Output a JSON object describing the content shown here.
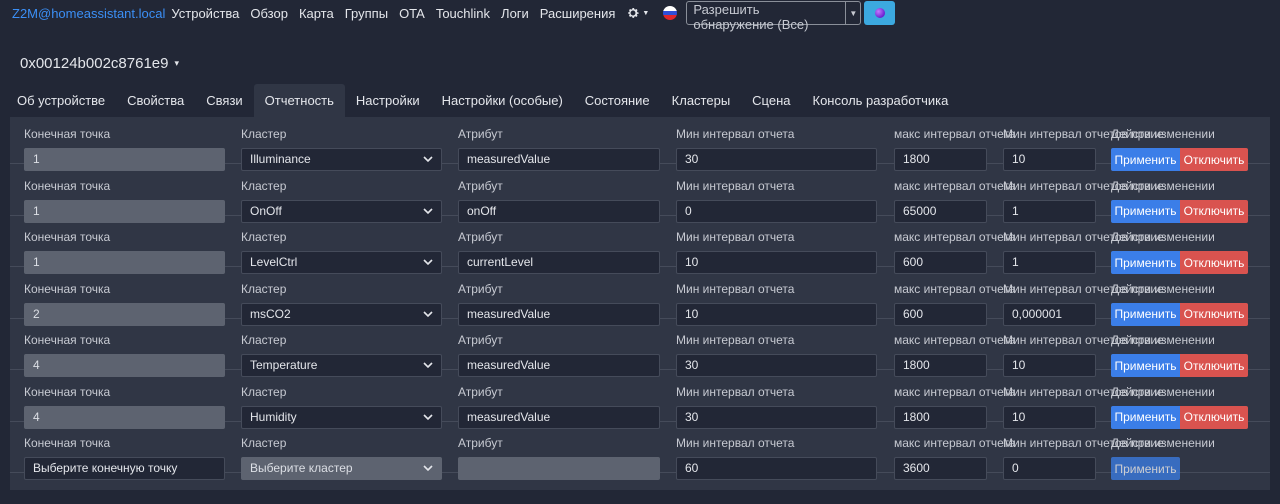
{
  "nav": {
    "brand": "Z2M@homeassistant.local",
    "links": [
      "Устройства",
      "Обзор",
      "Карта",
      "Группы",
      "OTA",
      "Touchlink",
      "Логи",
      "Расширения"
    ],
    "permit_join_label": "Разрешить обнаружение (Все)"
  },
  "device": {
    "title": "0x00124b002c8761e9"
  },
  "tabs": [
    "Об устройстве",
    "Свойства",
    "Связи",
    "Отчетность",
    "Настройки",
    "Настройки (особые)",
    "Состояние",
    "Кластеры",
    "Сцена",
    "Консоль разработчика"
  ],
  "active_tab": "Отчетность",
  "labels": {
    "endpoint": "Конечная точка",
    "cluster": "Кластер",
    "attribute": "Атрибут",
    "min_interval": "Мин интервал отчета",
    "max_interval": "макс интервал отчета",
    "min_change": "Мин интервал отчетов при изменении",
    "actions": "Действие"
  },
  "buttons": {
    "apply": "Применить",
    "disable": "Отключить"
  },
  "rows": [
    {
      "endpoint": "1",
      "cluster": "Illuminance",
      "attribute": "measuredValue",
      "min": "30",
      "max": "1800",
      "change": "10"
    },
    {
      "endpoint": "1",
      "cluster": "OnOff",
      "attribute": "onOff",
      "min": "0",
      "max": "65000",
      "change": "1"
    },
    {
      "endpoint": "1",
      "cluster": "LevelCtrl",
      "attribute": "currentLevel",
      "min": "10",
      "max": "600",
      "change": "1"
    },
    {
      "endpoint": "2",
      "cluster": "msCO2",
      "attribute": "measuredValue",
      "min": "10",
      "max": "600",
      "change": "0,000001"
    },
    {
      "endpoint": "4",
      "cluster": "Temperature",
      "attribute": "measuredValue",
      "min": "30",
      "max": "1800",
      "change": "10"
    },
    {
      "endpoint": "4",
      "cluster": "Humidity",
      "attribute": "measuredValue",
      "min": "30",
      "max": "1800",
      "change": "10"
    }
  ],
  "new_row": {
    "endpoint_placeholder": "Выберите конечную точку",
    "cluster_placeholder": "Выберите кластер",
    "attribute": "",
    "min": "60",
    "max": "3600",
    "change": "0"
  },
  "colors": {
    "brand": "#3b8ff6",
    "apply": "#3b7ee8",
    "disable": "#d9534f",
    "info": "#3ca9e0"
  }
}
